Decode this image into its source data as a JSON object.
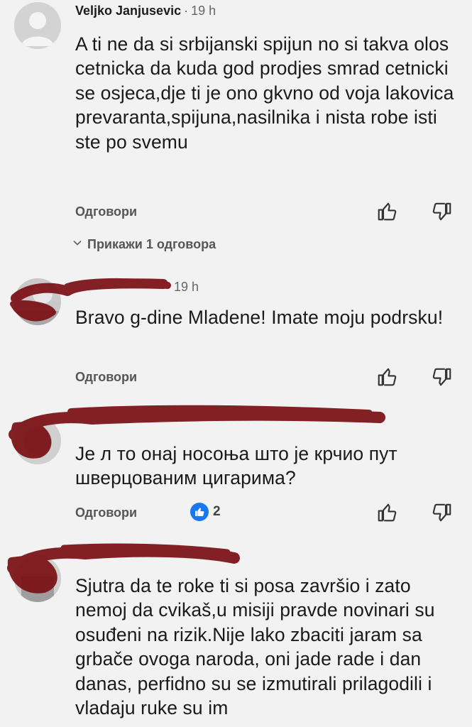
{
  "comments": [
    {
      "author": "Veljko Janjusevic",
      "time": "19 h",
      "body": "A ti ne da si srbijanski spijun no si takva olos cetnicka da kuda god prodjes smrad cetnicki se osjeca,dje ti je ono gkvno od voja lakovica prevaranta,spijuna,nasilnika i nista robe isti ste po svemu",
      "reply_label": "Одговори",
      "show_replies": "Прикажи 1 одговора"
    },
    {
      "author_visible": "...",
      "time": "19 h",
      "body": "Bravo g-dine Mladene! Imate moju podrsku!",
      "reply_label": "Одговори"
    },
    {
      "body": "Је л то онај носоња што је крчио пут шверцованим цигарима?",
      "reply_label": "Одговори",
      "like_count": "2"
    },
    {
      "body": "Sjutra da te roke ti si posa završio i zato nemoj da cvikaš,u misiji pravde novinari su osuđeni na rizik.Nije lako zbaciti jaram sa grbače ovoga naroda, oni jade rade i dan danas, perfidno su se izmutirali prilagodili i vladaju ruke su im",
      "reply_label": null
    }
  ],
  "icons": {
    "like": "thumbs-up-outline",
    "dislike": "thumbs-down-outline",
    "reaction": "like-badge-blue"
  },
  "colors": {
    "background": "#f2f2f2",
    "redaction": "#7a0f14",
    "like_badge": "#1877f2"
  }
}
